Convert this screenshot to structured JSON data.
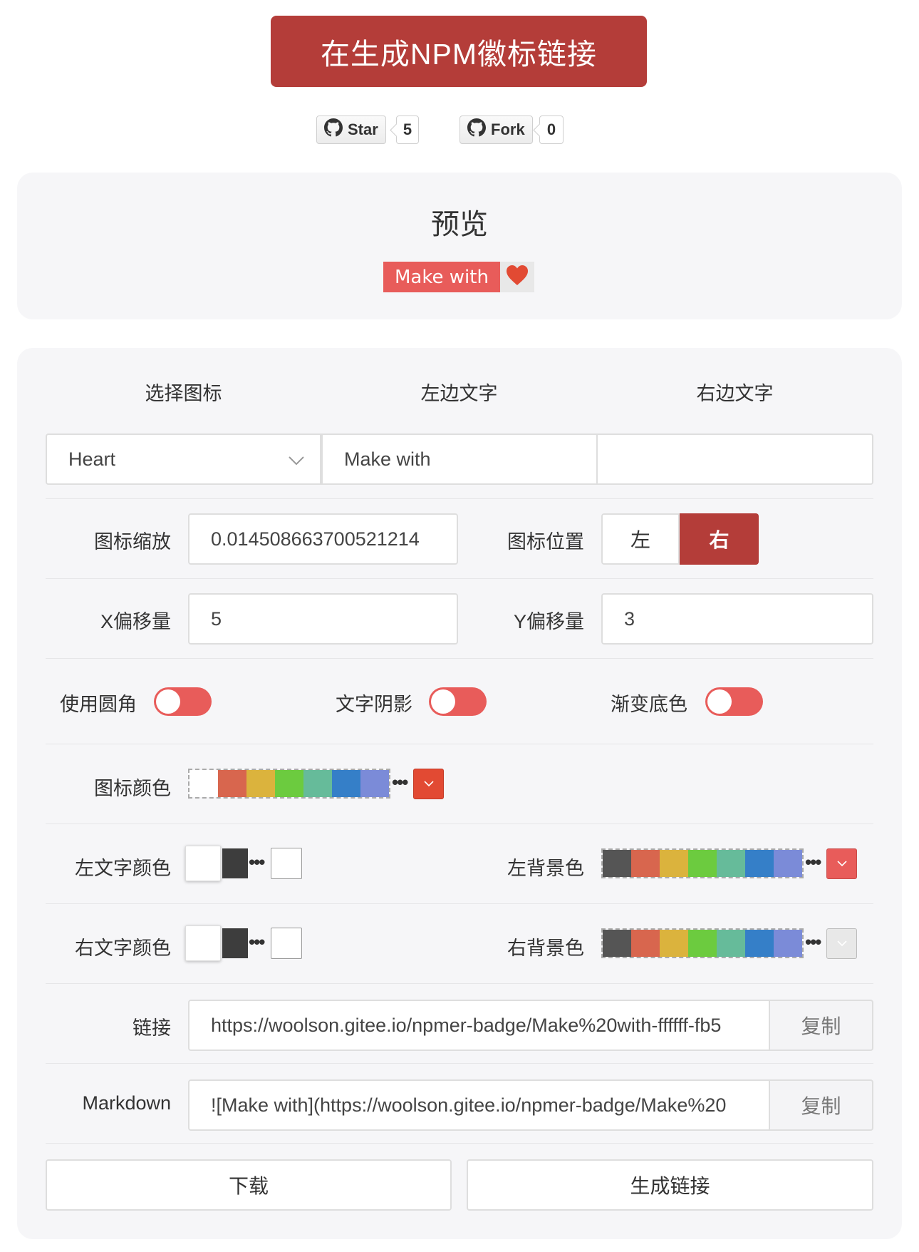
{
  "header": {
    "title": "在生成NPM徽标链接",
    "github": {
      "star_label": "Star",
      "star_count": "5",
      "fork_label": "Fork",
      "fork_count": "0",
      "icon": "github-icon"
    }
  },
  "preview": {
    "title": "预览",
    "badge_left_text": "Make with",
    "badge_icon": "heart-icon",
    "badge_left_color": "#e85c5a",
    "badge_right_color": "#e8e8e8",
    "icon_color": "#e24a33"
  },
  "form": {
    "headers": {
      "icon": "选择图标",
      "left_text": "左边文字",
      "right_text": "右边文字"
    },
    "icon_select_value": "Heart",
    "left_text_value": "Make with",
    "right_text_value": "",
    "scale": {
      "label": "图标缩放",
      "value": "0.014508663700521214"
    },
    "position": {
      "label": "图标位置",
      "left": "左",
      "right": "右",
      "selected": "右"
    },
    "x_offset": {
      "label": "X偏移量",
      "value": "5"
    },
    "y_offset": {
      "label": "Y偏移量",
      "value": "3"
    },
    "toggles": [
      {
        "label": "使用圆角",
        "on": false
      },
      {
        "label": "文字阴影",
        "on": false
      },
      {
        "label": "渐变底色",
        "on": false
      }
    ],
    "icon_color": {
      "label": "图标颜色",
      "selected": "#e24a33"
    },
    "left_text_color": {
      "label": "左文字颜色"
    },
    "left_bg_color": {
      "label": "左背景色",
      "selected": "#e85c5a"
    },
    "right_text_color": {
      "label": "右文字颜色"
    },
    "right_bg_color": {
      "label": "右背景色",
      "selected": "#e8e8e8"
    },
    "link": {
      "label": "链接",
      "value": "https://woolson.gitee.io/npmer-badge/Make%20with-ffffff-fb5",
      "copy": "复制"
    },
    "markdown": {
      "label": "Markdown",
      "value": "![Make with](https://woolson.gitee.io/npmer-badge/Make%20",
      "copy": "复制"
    },
    "download": "下载",
    "generate": "生成链接"
  },
  "colors": {
    "brand": "#b43d39",
    "switch": "#e85c5a",
    "palette_icon": [
      "#ffffff",
      "#d8664e",
      "#dbb33d",
      "#6ccb3f",
      "#66bb9a",
      "#357fc8",
      "#7b8bd8"
    ],
    "palette_bg": [
      "#555555",
      "#d8664e",
      "#dbb33d",
      "#6ccb3f",
      "#66bb9a",
      "#357fc8",
      "#7b8bd8"
    ]
  }
}
